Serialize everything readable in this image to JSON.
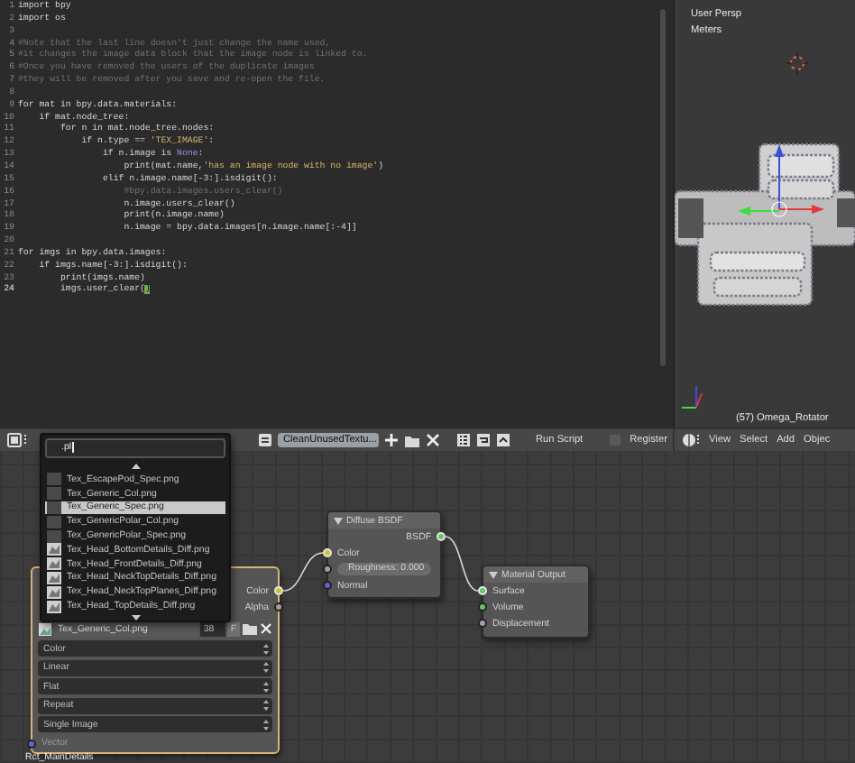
{
  "text_editor": {
    "lines": [
      {
        "number": "1",
        "current": false,
        "segments": [
          {
            "text": "import bpy",
            "kind": "code"
          }
        ]
      },
      {
        "number": "2",
        "current": false,
        "segments": [
          {
            "text": "import os",
            "kind": "code"
          }
        ]
      },
      {
        "number": "3",
        "current": false
      },
      {
        "number": "4",
        "current": false,
        "segments": [
          {
            "text": "#Note that the last line doesn't just change the name used,",
            "kind": "comment"
          }
        ]
      },
      {
        "number": "5",
        "current": false,
        "segments": [
          {
            "text": "#it changes the image data block that the image node is linked to.",
            "kind": "comment"
          }
        ]
      },
      {
        "number": "6",
        "current": false,
        "segments": [
          {
            "text": "#Once you have removed the users of the duplicate images",
            "kind": "comment"
          }
        ]
      },
      {
        "number": "7",
        "current": false,
        "segments": [
          {
            "text": "#they will be removed after you save and re-open the file.",
            "kind": "comment"
          }
        ]
      },
      {
        "number": "8",
        "current": false
      },
      {
        "number": "9",
        "current": false,
        "segments": [
          {
            "text": "for mat in bpy.data.materials:",
            "kind": "code"
          }
        ]
      },
      {
        "number": "10",
        "current": false,
        "segments": [
          {
            "text": "    if mat.node_tree:",
            "kind": "code"
          }
        ]
      },
      {
        "number": "11",
        "current": false,
        "segments": [
          {
            "text": "        for n in mat.node_tree.nodes:",
            "kind": "code"
          }
        ]
      },
      {
        "number": "12",
        "current": false,
        "segments": [
          {
            "text": "            if n.type == ",
            "kind": "code"
          },
          {
            "text": "'TEX_IMAGE'",
            "kind": "string"
          },
          {
            "text": ":",
            "kind": "code"
          }
        ]
      },
      {
        "number": "13",
        "current": false,
        "segments": [
          {
            "text": "                if n.image is ",
            "kind": "code"
          },
          {
            "text": "None",
            "kind": "special"
          },
          {
            "text": ":",
            "kind": "code"
          }
        ]
      },
      {
        "number": "14",
        "current": false,
        "segments": [
          {
            "text": "                    print(mat.name,",
            "kind": "code"
          },
          {
            "text": "'has an image node with no image'",
            "kind": "string"
          },
          {
            "text": ")",
            "kind": "code"
          }
        ]
      },
      {
        "number": "15",
        "current": false,
        "segments": [
          {
            "text": "                elif n.image.name[-3:].isdigit():",
            "kind": "code"
          }
        ]
      },
      {
        "number": "16",
        "current": false,
        "segments": [
          {
            "text": "                    #bpy.data.images.users_clear()",
            "kind": "comment"
          }
        ]
      },
      {
        "number": "17",
        "current": false,
        "segments": [
          {
            "text": "                    n.image.users_clear()",
            "kind": "code"
          }
        ]
      },
      {
        "number": "18",
        "current": false,
        "segments": [
          {
            "text": "                    print(n.image.name)",
            "kind": "code"
          }
        ]
      },
      {
        "number": "19",
        "current": false,
        "segments": [
          {
            "text": "                    n.image = bpy.data.images[n.image.name[:-4]]",
            "kind": "code"
          }
        ]
      },
      {
        "number": "20",
        "current": false
      },
      {
        "number": "21",
        "current": false,
        "segments": [
          {
            "text": "for imgs in bpy.data.images:",
            "kind": "code"
          }
        ]
      },
      {
        "number": "22",
        "current": false,
        "segments": [
          {
            "text": "    if imgs.name[-3:].isdigit():",
            "kind": "code"
          }
        ]
      },
      {
        "number": "23",
        "current": false,
        "segments": [
          {
            "text": "        print(imgs.name)",
            "kind": "code"
          }
        ]
      },
      {
        "number": "24",
        "current": true,
        "segments": [
          {
            "text": "        imgs.user_clear(",
            "kind": "code"
          },
          {
            "text": ")",
            "kind": "cursor"
          }
        ]
      }
    ]
  },
  "viewport": {
    "view_name": "User Persp",
    "units": "Meters",
    "object_label": "(57) Omega_Rotator"
  },
  "header": {
    "text_block_name": "CleanUnusedTextu...",
    "run_script": "Run Script",
    "register": {
      "label": "Register",
      "checked": false
    },
    "viewport_menu": [
      "View",
      "Select",
      "Add",
      "Objec"
    ]
  },
  "image_browser": {
    "search": ".pl",
    "items": [
      {
        "label": "Tex_EscapePod_Spec.png",
        "selected": false,
        "kind": "plain"
      },
      {
        "label": "Tex_Generic_Col.png",
        "selected": false,
        "kind": "plain"
      },
      {
        "label": "Tex_Generic_Spec.png",
        "selected": true,
        "kind": "plain"
      },
      {
        "label": "Tex_GenericPolar_Col.png",
        "selected": false,
        "kind": "plain"
      },
      {
        "label": "Tex_GenericPolar_Spec.png",
        "selected": false,
        "kind": "plain"
      },
      {
        "label": "Tex_Head_BottomDetails_Diff.png",
        "selected": false,
        "kind": "image"
      },
      {
        "label": "Tex_Head_FrontDetails_Diff.png",
        "selected": false,
        "kind": "image"
      },
      {
        "label": "Tex_Head_NeckTopDetails_Diff.png",
        "selected": false,
        "kind": "image"
      },
      {
        "label": "Tex_Head_NeckTopPlanes_Diff.png",
        "selected": false,
        "kind": "image"
      },
      {
        "label": "Tex_Head_TopDetails_Diff.png",
        "selected": false,
        "kind": "image"
      }
    ]
  },
  "node_editor": {
    "frame_label": "Rct_MainDetails",
    "nodes": [
      {
        "kind": "image_texture",
        "selected": true,
        "outputs": [
          {
            "name": "Color",
            "kind": "color",
            "linked": true
          },
          {
            "name": "Alpha",
            "kind": "value",
            "linked": false
          }
        ],
        "image": {
          "name": "Tex_Generic_Col.png",
          "users": "38",
          "fake_user": "F"
        },
        "settings": [
          "Color",
          "Linear",
          "Flat",
          "Repeat",
          "Single Image"
        ],
        "inputs": [
          {
            "name": "Vector",
            "kind": "vector",
            "linked": false
          }
        ]
      },
      {
        "kind": "shader",
        "selected": false,
        "title": "Diffuse BSDF",
        "outputs": [
          {
            "name": "BSDF",
            "kind": "shader",
            "linked": true
          }
        ],
        "inputs": [
          {
            "name": "Color",
            "kind": "color",
            "linked": true
          },
          {
            "field": "Roughness: 0.000",
            "kind": "value",
            "linked": false
          },
          {
            "name": "Normal",
            "kind": "vector",
            "linked": false
          }
        ]
      },
      {
        "kind": "output",
        "selected": false,
        "title": "Material Output",
        "inputs": [
          {
            "name": "Surface",
            "kind": "shader",
            "linked": true
          },
          {
            "name": "Volume",
            "kind": "shader",
            "linked": false
          },
          {
            "name": "Displacement",
            "kind": "value",
            "linked": false
          }
        ]
      }
    ]
  }
}
